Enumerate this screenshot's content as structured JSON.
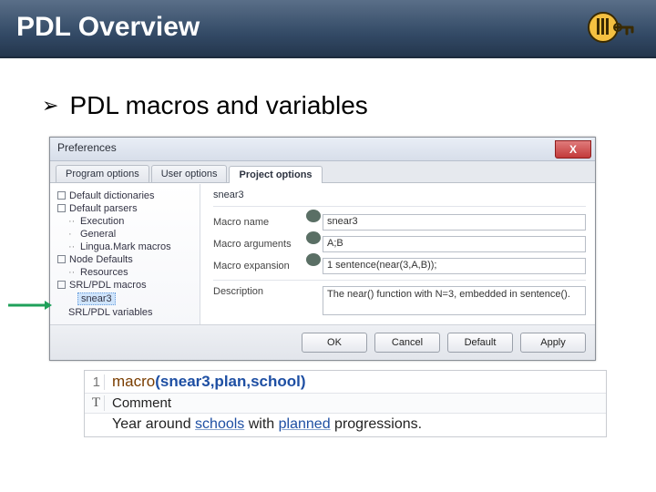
{
  "slide": {
    "title": "PDL Overview",
    "bullet": "PDL macros and variables"
  },
  "dialog": {
    "title": "Preferences",
    "close_glyph": "X",
    "tabs": [
      "Program options",
      "User options",
      "Project options"
    ],
    "active_tab": 2,
    "tree": {
      "items": [
        {
          "label": "Default dictionaries",
          "lvl": 0,
          "sq": true
        },
        {
          "label": "Default parsers",
          "lvl": 0,
          "sq": true
        },
        {
          "label": "Execution",
          "lvl": 1,
          "dots": true
        },
        {
          "label": "General",
          "lvl": 1,
          "dots": true
        },
        {
          "label": "Lingua.Mark macros",
          "lvl": 1,
          "dots": true
        },
        {
          "label": "Node Defaults",
          "lvl": 0,
          "sq": true
        },
        {
          "label": "Resources",
          "lvl": 1,
          "dots": true
        },
        {
          "label": "SRL/PDL macros",
          "lvl": 0,
          "sq": true
        },
        {
          "label": "snear3",
          "lvl": 2,
          "selected": true
        },
        {
          "label": "SRL/PDL variables",
          "lvl": 1
        }
      ]
    },
    "form": {
      "breadcrumb": "snear3",
      "rows": [
        {
          "label": "Macro name",
          "value": "snear3"
        },
        {
          "label": "Macro arguments",
          "value": "A;B"
        },
        {
          "label": "Macro expansion",
          "value": "1 sentence(near(3,A,B));"
        }
      ],
      "desc_label": "Description",
      "desc_value": "The near() function with N=3, embedded in sentence()."
    },
    "buttons": [
      "OK",
      "Cancel",
      "Default",
      "Apply"
    ]
  },
  "editor": {
    "line_no": "1",
    "macro_kw": "macro",
    "args": "(snear3,plan,school)",
    "comment_marker": "T",
    "comment_label": "Comment",
    "sentence_pre": "Year around ",
    "sentence_w1": "schools",
    "sentence_mid": " with ",
    "sentence_w2": "planned",
    "sentence_post": " progressions."
  }
}
